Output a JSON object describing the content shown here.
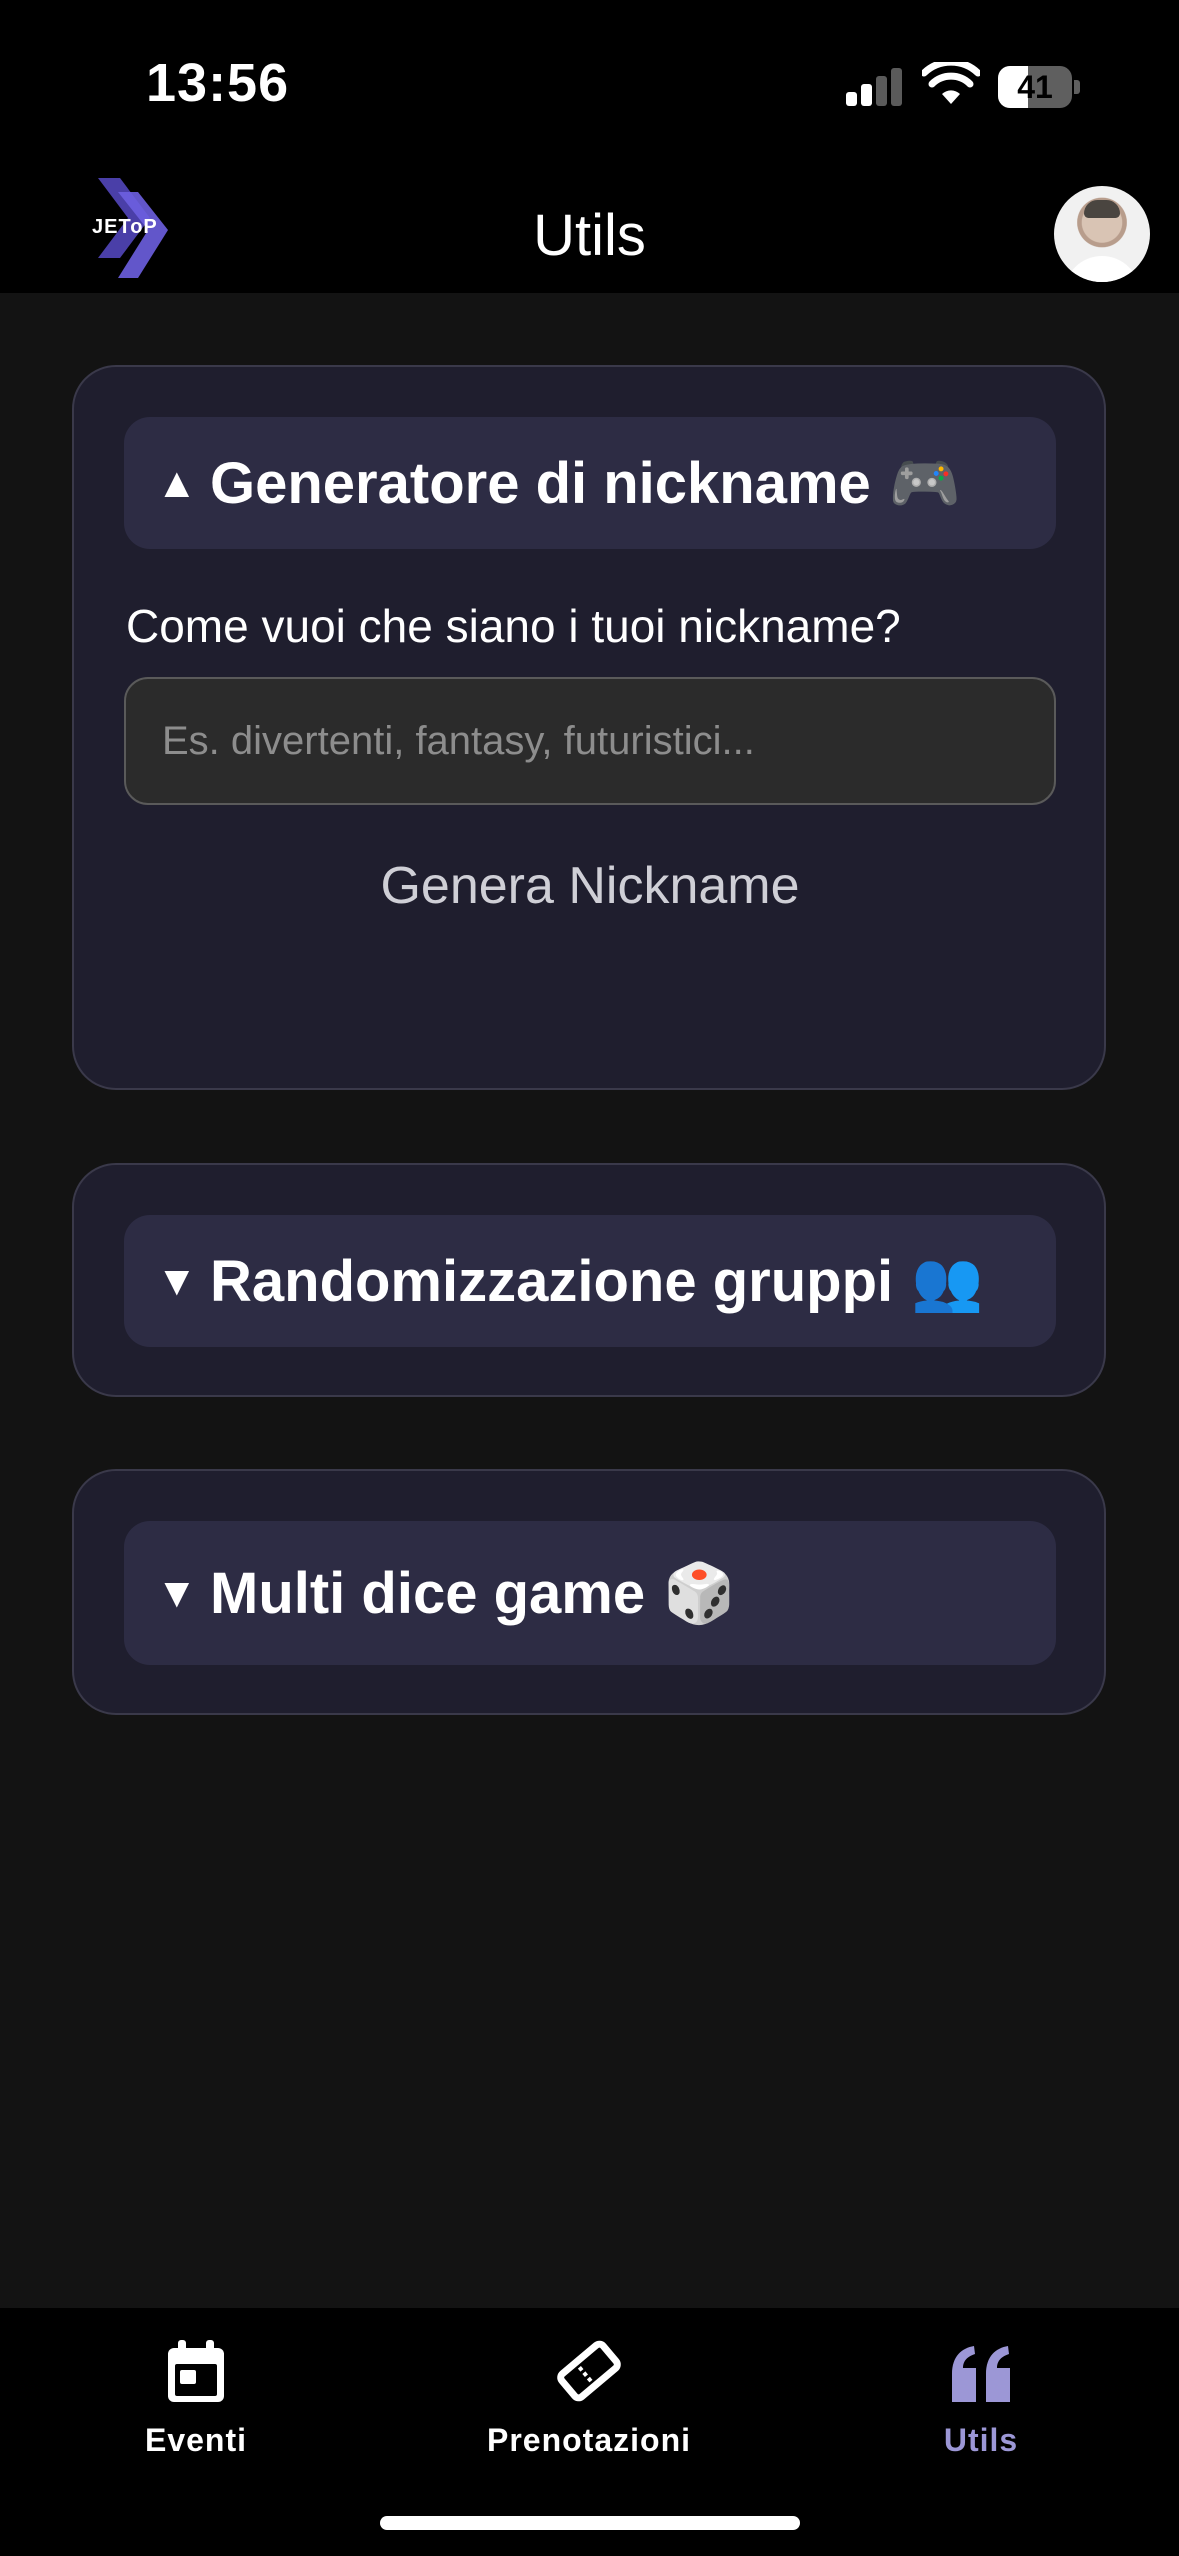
{
  "status_bar": {
    "time": "13:56",
    "battery": "41",
    "battery_level": 0.41
  },
  "header": {
    "title": "Utils",
    "logo_text": "JEToP"
  },
  "cards": {
    "nickname": {
      "caret": "▲",
      "title": "Generatore di nickname",
      "emoji": "🎮",
      "question": "Come vuoi che siano i tuoi nickname?",
      "input_placeholder": "Es. divertenti, fantasy, futuristici...",
      "input_value": "",
      "button": "Genera Nickname"
    },
    "groups": {
      "caret": "▼",
      "title": "Randomizzazione gruppi",
      "emoji": "👥"
    },
    "dice": {
      "caret": "▼",
      "title": "Multi dice game",
      "emoji": "🎲"
    }
  },
  "bottom_nav": {
    "items": [
      {
        "label": "Eventi",
        "icon": "calendar-icon"
      },
      {
        "label": "Prenotazioni",
        "icon": "ticket-icon"
      },
      {
        "label": "Utils",
        "icon": "quote-icon",
        "active": true
      }
    ]
  },
  "colors": {
    "background": "#131313",
    "card": "#1f1e2e",
    "card_header": "#2d2c44",
    "accent": "#9c97d6"
  }
}
